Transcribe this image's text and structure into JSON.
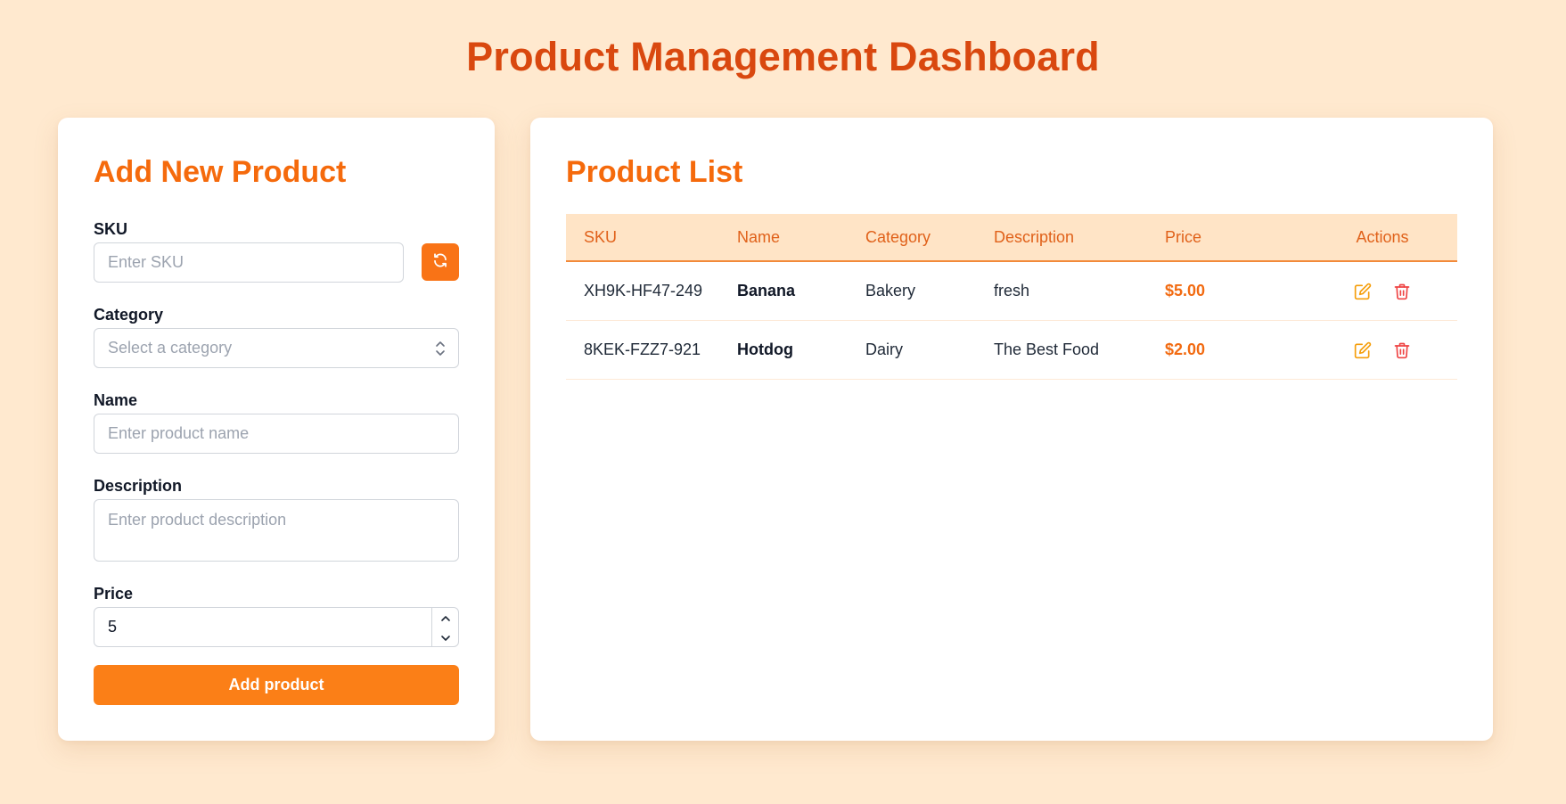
{
  "page_title": "Product Management Dashboard",
  "form": {
    "title": "Add New Product",
    "sku_label": "SKU",
    "sku_placeholder": "Enter SKU",
    "category_label": "Category",
    "category_placeholder": "Select a category",
    "name_label": "Name",
    "name_placeholder": "Enter product name",
    "description_label": "Description",
    "description_placeholder": "Enter product description",
    "price_label": "Price",
    "price_value": "5",
    "submit_label": "Add product",
    "icons": {
      "refresh": "refresh-icon",
      "select": "chevron-up-down-icon",
      "stepper_up": "chevron-up-icon",
      "stepper_down": "chevron-down-icon"
    }
  },
  "list": {
    "title": "Product List",
    "columns": [
      "SKU",
      "Name",
      "Category",
      "Description",
      "Price",
      "Actions"
    ],
    "rows": [
      {
        "sku": "XH9K-HF47-249",
        "name": "Banana",
        "category": "Bakery",
        "description": "fresh",
        "price": "$5.00"
      },
      {
        "sku": "8KEK-FZZ7-921",
        "name": "Hotdog",
        "category": "Dairy",
        "description": "The Best Food",
        "price": "$2.00"
      }
    ],
    "action_icons": [
      "edit-icon",
      "trash-icon"
    ]
  },
  "colors": {
    "background": "#ffe9cf",
    "title": "#d9480f",
    "accent": "#f97316",
    "delete": "#ef4444"
  }
}
